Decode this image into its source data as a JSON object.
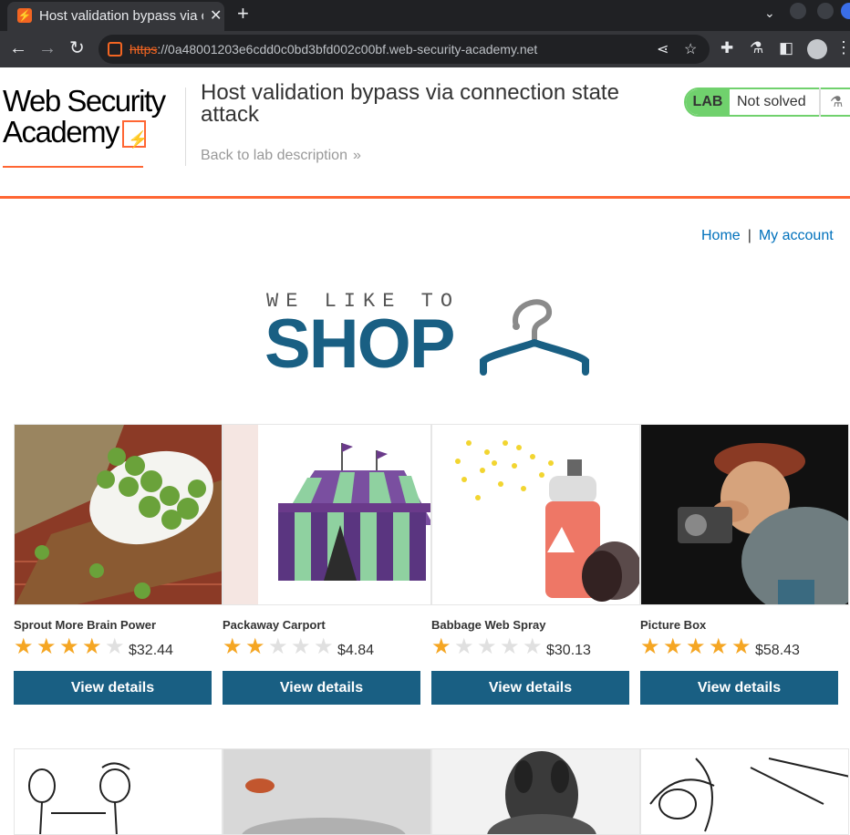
{
  "browser": {
    "tab_title": "Host validation bypass via connection state attack",
    "url_scheme": "https",
    "url_rest": "://0a48001203e6cdd0c0bd3bfd002c00bf.web-security-academy.net"
  },
  "header": {
    "logo_line1": "Web Security",
    "logo_line2": "Academy",
    "lab_title": "Host validation bypass via connection state attack",
    "back_link": "Back to lab description",
    "lab_badge": "LAB",
    "status": "Not solved"
  },
  "nav": {
    "home": "Home",
    "separator": "|",
    "my_account": "My account"
  },
  "banner": {
    "small": "WE LIKE TO",
    "big": "SHOP"
  },
  "products": [
    {
      "name": "Sprout More Brain Power",
      "rating": 4,
      "price": "$32.44",
      "button": "View details"
    },
    {
      "name": "Packaway Carport",
      "rating": 2,
      "price": "$4.84",
      "button": "View details"
    },
    {
      "name": "Babbage Web Spray",
      "rating": 1,
      "price": "$30.13",
      "button": "View details"
    },
    {
      "name": "Picture Box",
      "rating": 5,
      "price": "$58.43",
      "button": "View details"
    }
  ],
  "colors": {
    "brand_orange": "#ff6633",
    "shop_blue": "#195f83",
    "link_blue": "#0071bc",
    "lab_green": "#70d16d",
    "star_gold": "#f5a623"
  }
}
